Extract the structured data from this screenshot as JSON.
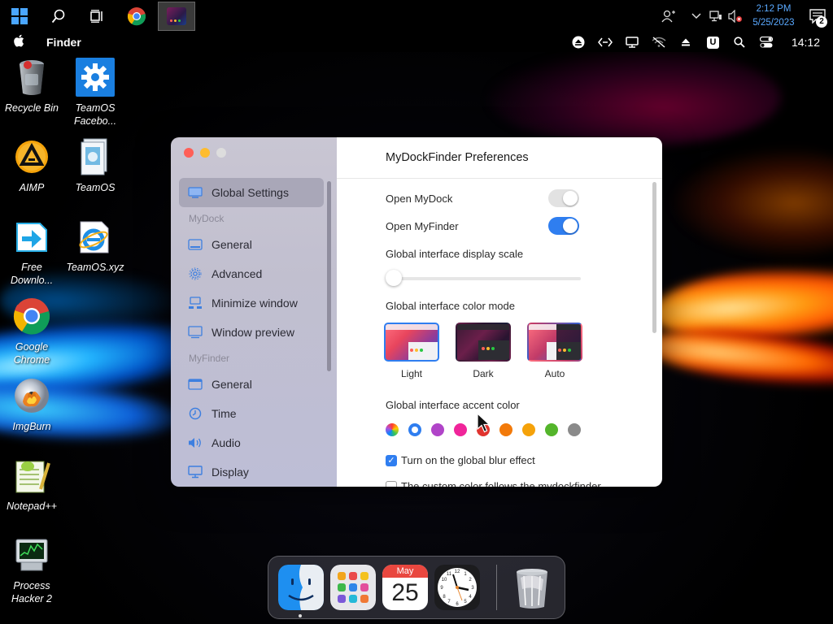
{
  "taskbar": {
    "clock_time": "2:12 PM",
    "clock_date": "5/25/2023",
    "notification_count": "2"
  },
  "menubar": {
    "app_name": "Finder",
    "time": "14:12"
  },
  "desktop_icons": [
    {
      "label": "Recycle Bin",
      "icon": "recycle-bin-icon"
    },
    {
      "label": "TeamOS Facebo...",
      "icon": "gear-icon"
    },
    {
      "label": "AIMP",
      "icon": "aimp-icon"
    },
    {
      "label": "TeamOS",
      "icon": "teamos-icon"
    },
    {
      "label": "Free Downlo...",
      "icon": "download-icon"
    },
    {
      "label": "TeamOS.xyz",
      "icon": "internet-explorer-icon"
    },
    {
      "label": "Google Chrome",
      "icon": "chrome-icon"
    },
    {
      "label": "ImgBurn",
      "icon": "disc-icon"
    },
    {
      "label": "Notepad++",
      "icon": "notepad-icon"
    },
    {
      "label": "Process Hacker 2",
      "icon": "process-hacker-icon"
    }
  ],
  "prefs": {
    "title": "MyDockFinder Preferences",
    "sidebar": {
      "global_settings": "Global Settings",
      "section_mydock": "MyDock",
      "general": "General",
      "advanced": "Advanced",
      "minimize_window": "Minimize window",
      "window_preview": "Window preview",
      "section_myfinder": "MyFinder",
      "general2": "General",
      "time": "Time",
      "audio": "Audio",
      "display": "Display"
    },
    "open_mydock": "Open MyDock",
    "open_myfinder": "Open MyFinder",
    "open_mydock_state": "off",
    "open_myfinder_state": "on",
    "display_scale_label": "Global interface display scale",
    "display_scale_value": 0,
    "color_mode_label": "Global interface color mode",
    "color_modes": [
      "Light",
      "Dark",
      "Auto"
    ],
    "selected_color_mode": "Light",
    "accent_label": "Global interface accent color",
    "accent_colors": [
      "#7a5cf5",
      "#2f7ef0",
      "#b044c8",
      "#f0259a",
      "#e0342f",
      "#f27a0a",
      "#f5a20a",
      "#54b52b",
      "#8a8a8a"
    ],
    "selected_accent": "#2f7ef0",
    "blur_label": "Turn on the global blur effect",
    "blur_checked": true,
    "custom_color_label": "The custom color follows the mydockfinder"
  },
  "dock": {
    "calendar_month": "May",
    "calendar_day": "25"
  }
}
